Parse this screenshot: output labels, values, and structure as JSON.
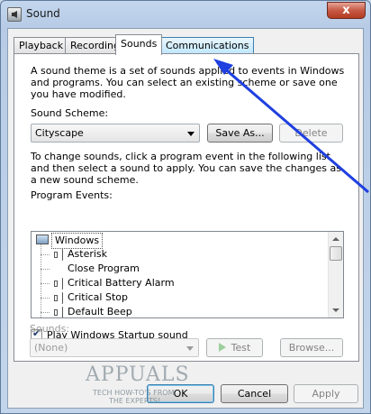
{
  "window": {
    "title": "Sound",
    "close_glyph": "x"
  },
  "tabs": [
    {
      "label": "Playback"
    },
    {
      "label": "Recording"
    },
    {
      "label": "Sounds"
    },
    {
      "label": "Communications"
    }
  ],
  "sounds": {
    "description": "A sound theme is a set of sounds applied to events in Windows and programs.  You can select an existing scheme or save one you have modified.",
    "scheme_label": "Sound Scheme:",
    "scheme_value": "Cityscape",
    "save_as_label": "Save As...",
    "delete_label": "Delete",
    "instructions": "To change sounds, click a program event in the following list and then select a sound to apply.  You can save the changes as a new sound scheme.",
    "events_label": "Program Events:",
    "events": [
      {
        "label": "Windows"
      },
      {
        "label": "Asterisk"
      },
      {
        "label": "Close Program"
      },
      {
        "label": "Critical Battery Alarm"
      },
      {
        "label": "Critical Stop"
      },
      {
        "label": "Default Beep"
      }
    ],
    "startup_label": "Play Windows Startup sound",
    "sounds_label": "Sounds:",
    "sounds_value": "(None)",
    "test_label": "Test",
    "browse_label": "Browse..."
  },
  "footer": {
    "ok_label": "OK",
    "cancel_label": "Cancel",
    "apply_label": "Apply"
  },
  "watermark": {
    "brand": "APPUALS",
    "tagline_1": "TECH HOW-TO'S FROM",
    "tagline_2": "THE EXPERTS!"
  },
  "colors": {
    "arrow": "#1f3fe0",
    "title_bar": "#c3d6ee",
    "close_button": "#c75a45"
  }
}
